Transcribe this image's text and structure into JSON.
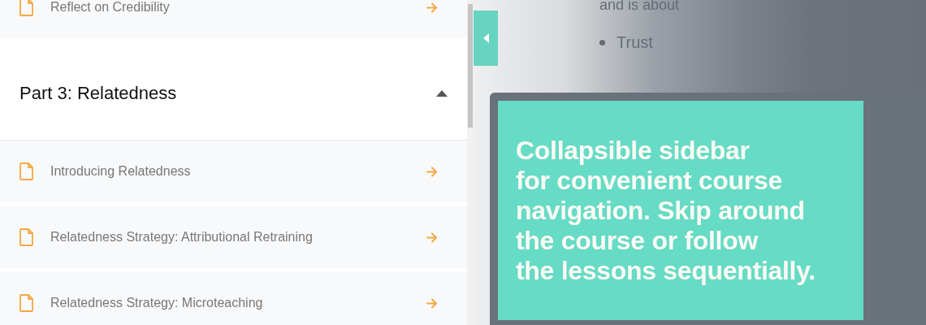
{
  "sidebar": {
    "lessons": [
      {
        "title": "Reflect on Credibility"
      }
    ],
    "section": {
      "title": "Part 3: Relatedness",
      "expanded": true,
      "lessons": [
        {
          "title": "Introducing Relatedness"
        },
        {
          "title": "Relatedness Strategy: Attributional Retraining"
        },
        {
          "title": "Relatedness Strategy: Microteaching"
        }
      ]
    }
  },
  "content": {
    "text": "and is about",
    "bullets": [
      "Trust"
    ]
  },
  "callout": {
    "lines": [
      "Collapsible sidebar",
      "for convenient course",
      "navigation. Skip around",
      "the course or follow",
      "the lessons sequentially."
    ]
  }
}
